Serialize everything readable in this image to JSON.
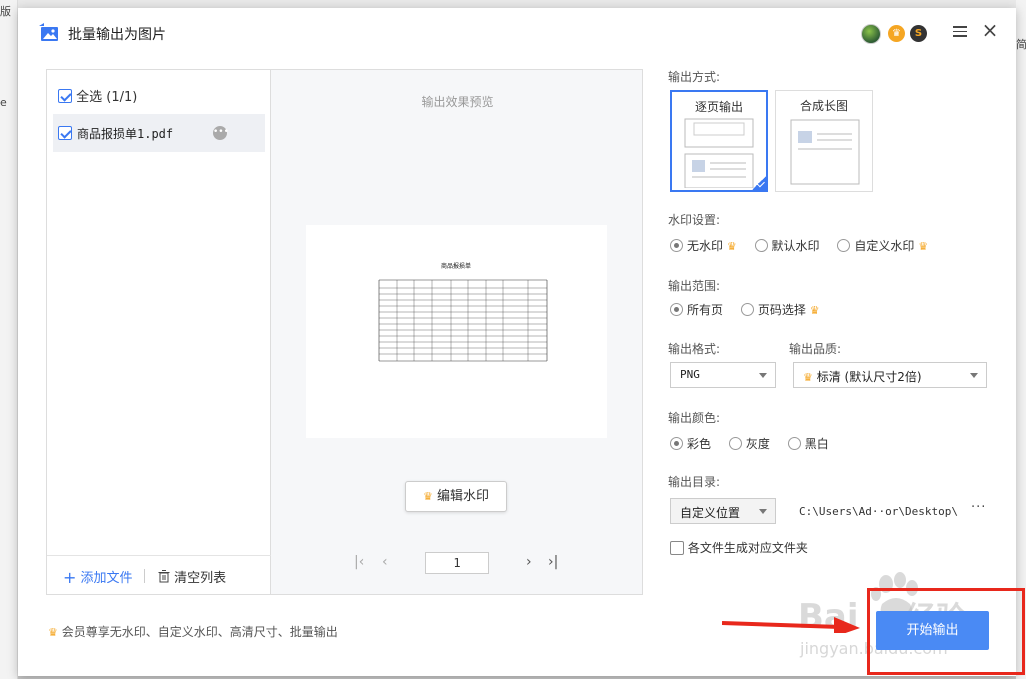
{
  "background": {
    "left_top_text": "版",
    "left_mid_text": "e",
    "right_text": "简"
  },
  "dialog": {
    "title": "批量输出为图片"
  },
  "file_list": {
    "select_all": "全选 (1/1)",
    "files": [
      {
        "name": "商品报损单1.pdf",
        "checked": true
      }
    ],
    "add_file": "添加文件",
    "clear_list": "清空列表"
  },
  "preview": {
    "title": "输出效果预览",
    "doc_title": "商品报损单",
    "edit_watermark": "编辑水印",
    "page": "1"
  },
  "vip_note": "会员尊享无水印、自定义水印、高清尺寸、批量输出",
  "settings": {
    "output_mode_label": "输出方式:",
    "modes": [
      {
        "label": "逐页输出",
        "selected": true
      },
      {
        "label": "合成长图",
        "selected": false
      }
    ],
    "watermark_label": "水印设置:",
    "watermark_options": [
      "无水印",
      "默认水印",
      "自定义水印"
    ],
    "watermark_selected": "无水印",
    "range_label": "输出范围:",
    "range_options": [
      "所有页",
      "页码选择"
    ],
    "range_selected": "所有页",
    "format_label": "输出格式:",
    "format_value": "PNG",
    "quality_label": "输出品质:",
    "quality_value": "标清 (默认尺寸2倍)",
    "color_label": "输出颜色:",
    "color_options": [
      "彩色",
      "灰度",
      "黑白"
    ],
    "color_selected": "彩色",
    "dir_label": "输出目录:",
    "dir_select": "自定义位置",
    "dir_path": "C:\\Users\\Ad··or\\Desktop\\",
    "dir_more": "···",
    "sub_folder": "各文件生成对应文件夹",
    "start": "开始输出"
  },
  "colors": {
    "accent": "#3a78f2",
    "crown": "#f5a623",
    "highlight": "#e8281c",
    "start_button": "#4a8af4"
  },
  "icons": [
    "image-export-icon",
    "avatar",
    "vip-crown-icon",
    "coin-icon",
    "menu-icon",
    "close-icon",
    "plus-icon",
    "trash-icon",
    "more-icon",
    "first-page-icon",
    "prev-page-icon",
    "next-page-icon",
    "last-page-icon"
  ]
}
